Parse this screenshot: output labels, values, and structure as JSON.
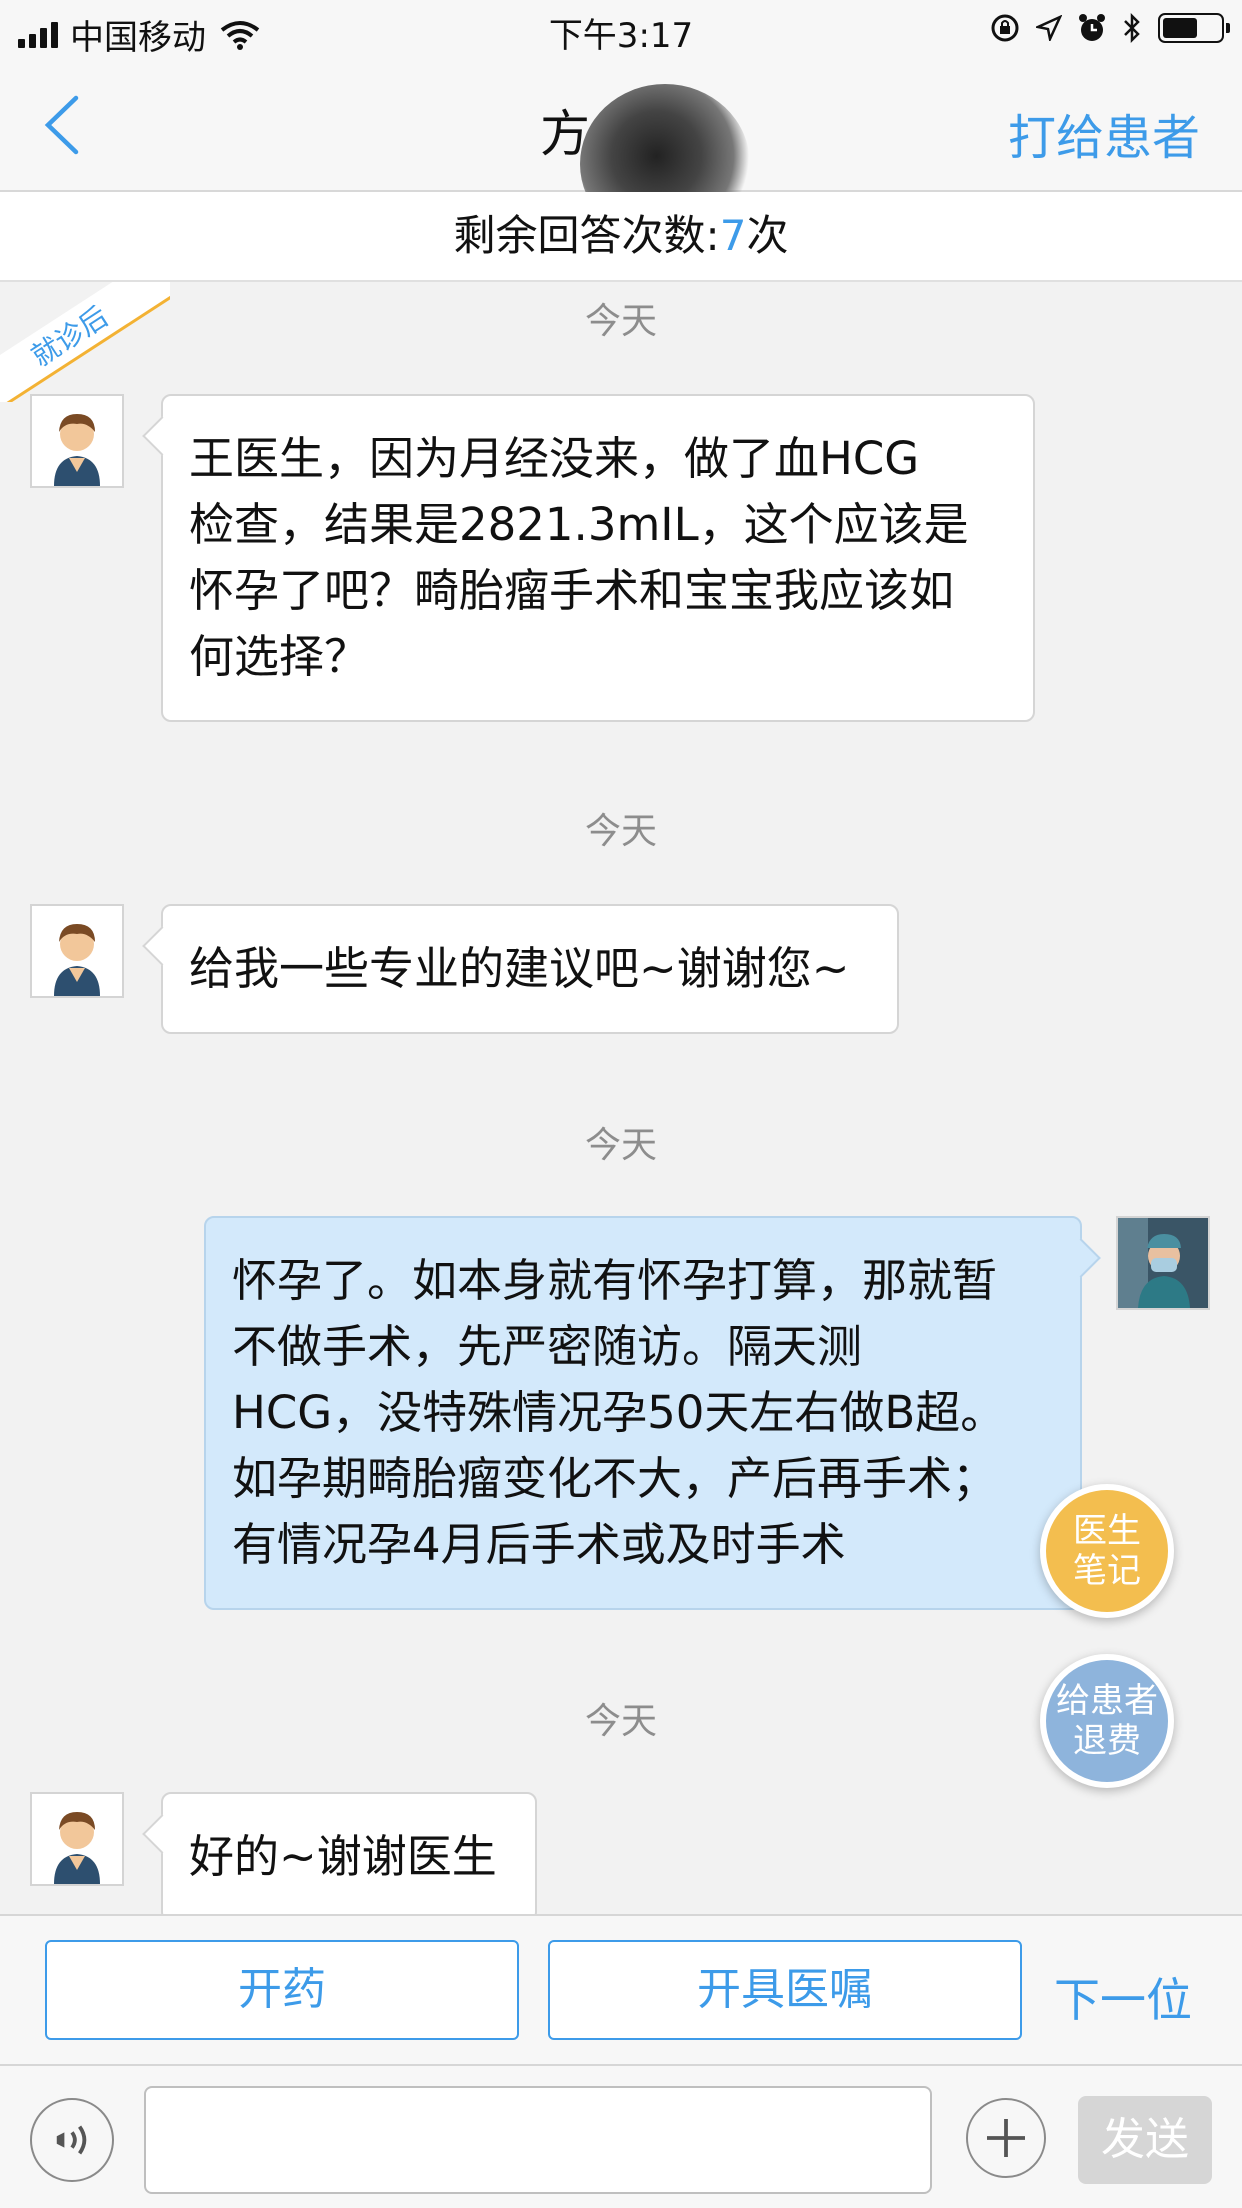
{
  "status_bar": {
    "carrier": "中国移动",
    "time": "下午3:17",
    "icons": [
      "signal-icon",
      "wifi-icon",
      "rotation-lock-icon",
      "location-icon",
      "alarm-icon",
      "bluetooth-icon",
      "battery-icon"
    ],
    "battery_level": 0.6
  },
  "nav": {
    "title": "方",
    "call_label": "打给患者"
  },
  "banner": {
    "label": "剩余回答次数:",
    "count": "7",
    "unit": "次"
  },
  "ribbon": {
    "label": "就诊后",
    "color": "#f3b234"
  },
  "messages": [
    {
      "day": "今天",
      "from": "patient",
      "text": "王医生，因为月经没来，做了血HCG\n检查，结果是2821.3mIL，这个应该是\n怀孕了吧？畸胎瘤手术和宝宝我应该如\n何选择？"
    },
    {
      "day": "今天",
      "from": "patient",
      "text": "给我一些专业的建议吧~谢谢您~"
    },
    {
      "day": "今天",
      "from": "doctor",
      "text": "怀孕了。如本身就有怀孕打算，那就暂\n不做手术，先严密随访。隔天测\nHCG，没特殊情况孕50天左右做B超。\n如孕期畸胎瘤变化不大，产后再手术；\n有情况孕4月后手术或及时手术"
    },
    {
      "day": "今天",
      "from": "patient",
      "text": "好的~谢谢医生"
    }
  ],
  "floating": {
    "notes_label": "医生\n笔记",
    "refund_label": "给患者\n退费",
    "notes_color": "#f3be4f",
    "refund_color": "#8eb4dc"
  },
  "actions": {
    "prescribe_label": "开药",
    "advice_label": "开具医嘱",
    "next_label": "下一位"
  },
  "input": {
    "value": "",
    "send_label": "发送"
  },
  "colors": {
    "accent": "#3d9be9",
    "doctor_bubble": "#d3e9fb"
  }
}
